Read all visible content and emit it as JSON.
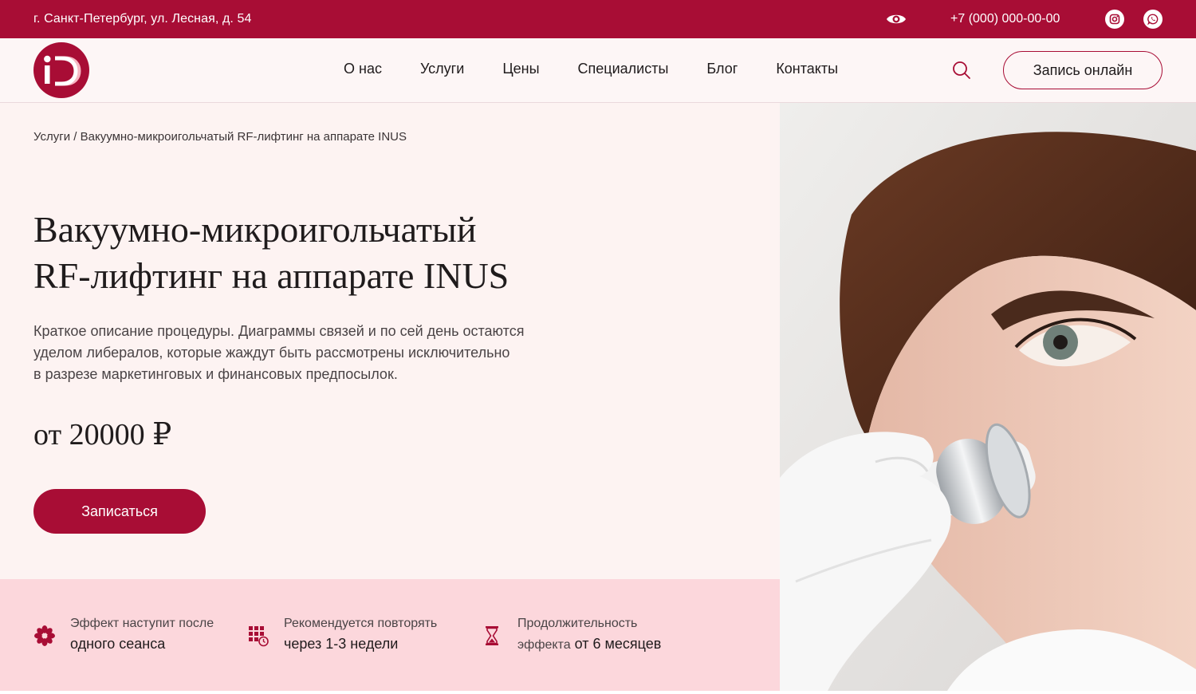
{
  "topbar": {
    "address": "г. Санкт-Петербург, ул. Лесная, д. 54",
    "phone": "+7 (000) 000-00-00",
    "icons": [
      "eye-icon",
      "instagram-icon",
      "whatsapp-icon"
    ]
  },
  "header": {
    "logo_text": "iD",
    "nav": [
      "О нас",
      "Услуги",
      "Цены",
      "Специалисты",
      "Блог",
      "Контакты"
    ],
    "booking_button": "Запись онлайн",
    "icons": [
      "search-icon"
    ]
  },
  "breadcrumb": {
    "parent": "Услуги",
    "separator": " / ",
    "current": "Вакуумно-микроигольчатый RF-лифтинг на аппарате INUS"
  },
  "hero": {
    "title_line1": "Вакуумно-микроигольчатый",
    "title_line2": "RF-лифтинг на аппарате INUS",
    "desc_line1": "Краткое описание процедуры. Диаграммы связей и по сей день остаются",
    "desc_line2": "уделом либералов, которые жаждут быть рассмотрены исключительно",
    "desc_line3": "в разрезе маркетинговых и финансовых предпосылок.",
    "price": "от 20000 ₽",
    "book_button": "Записаться"
  },
  "features": [
    {
      "icon": "flower-icon",
      "line1": "Эффект наступит после",
      "line2": "одного сеанса"
    },
    {
      "icon": "calendar-clock-icon",
      "line1": "Рекомендуется повторять",
      "line2": "через 1-3 недели"
    },
    {
      "icon": "hourglass-icon",
      "line1": "Продолжительность",
      "line2_muted": "эффекта",
      "line2": " от 6 месяцев"
    }
  ],
  "colors": {
    "brand": "#a80d35",
    "header_bg": "#fdf6f6",
    "hero_bg": "#fdf3f2",
    "features_bg": "#fcd7dc"
  }
}
